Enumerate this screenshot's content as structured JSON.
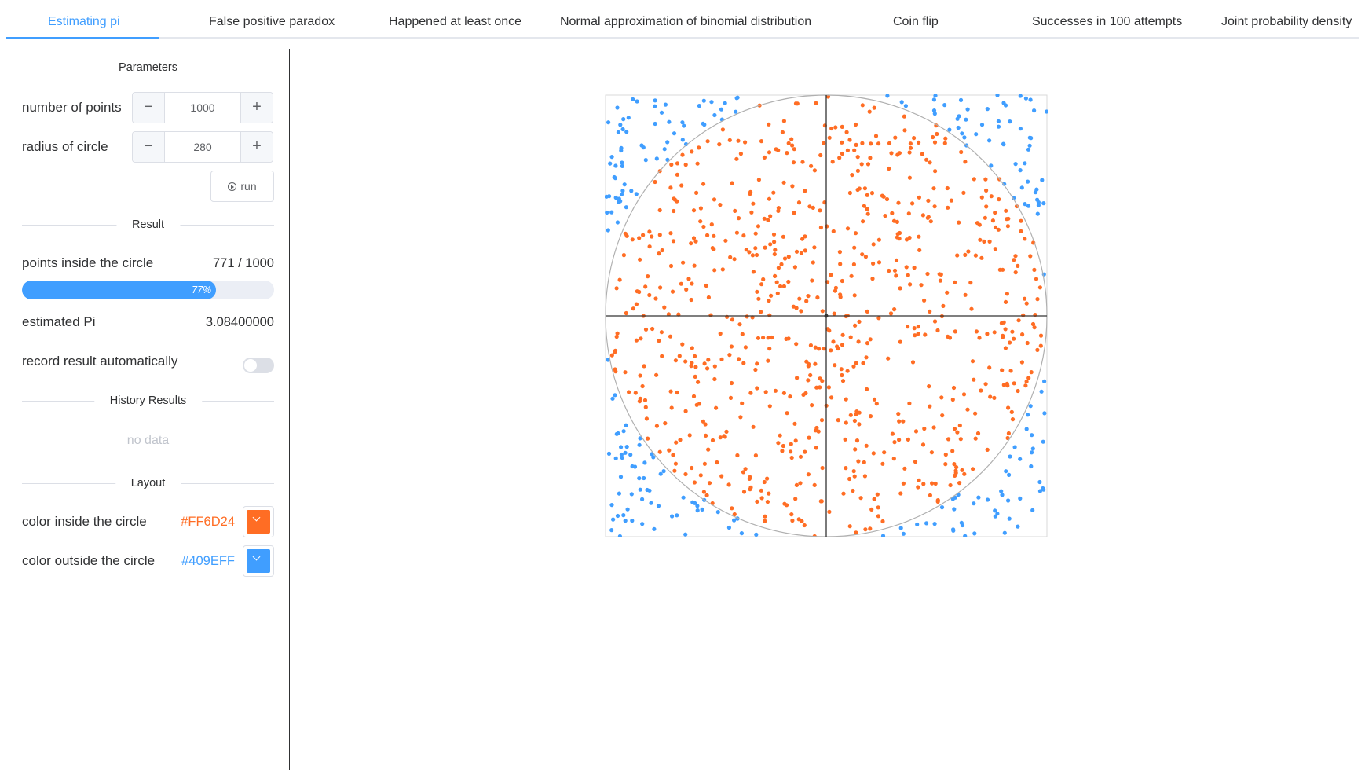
{
  "tabs": [
    {
      "label": "Estimating pi",
      "active": true
    },
    {
      "label": "False positive paradox"
    },
    {
      "label": "Happened at least once"
    },
    {
      "label": "Normal approximation of binomial distribution"
    },
    {
      "label": "Coin flip"
    },
    {
      "label": "Successes in 100 attempts"
    },
    {
      "label": "Joint probability density"
    }
  ],
  "parameters": {
    "title": "Parameters",
    "points_label": "number of points",
    "points_value": "1000",
    "radius_label": "radius of circle",
    "radius_value": "280",
    "run_label": "run",
    "minus_glyph": "−",
    "plus_glyph": "+"
  },
  "result": {
    "title": "Result",
    "inside_label": "points inside the circle",
    "inside_value": "771 / 1000",
    "progress_percent": 77,
    "progress_text": "77%",
    "pi_label": "estimated Pi",
    "pi_value": "3.08400000",
    "auto_record_label": "record result automatically",
    "auto_record_on": false
  },
  "history": {
    "title": "History Results",
    "empty_text": "no data"
  },
  "layout": {
    "title": "Layout",
    "inside_color_label": "color inside the circle",
    "inside_color": "#FF6D24",
    "outside_color_label": "color outside the circle",
    "outside_color": "#409EFF"
  },
  "chart_data": {
    "type": "scatter",
    "radius": 280,
    "total_points": 1000,
    "inside_points": 771,
    "inside_color": "#FF6D24",
    "outside_color": "#409EFF",
    "x_range": [
      -280,
      280
    ],
    "y_range": [
      -280,
      280
    ],
    "axes": "crosshair through origin",
    "circle_outline_color": "#b0b0b0",
    "points": "1000 uniformly random points in the square; individual coordinates not recoverable from the image"
  }
}
